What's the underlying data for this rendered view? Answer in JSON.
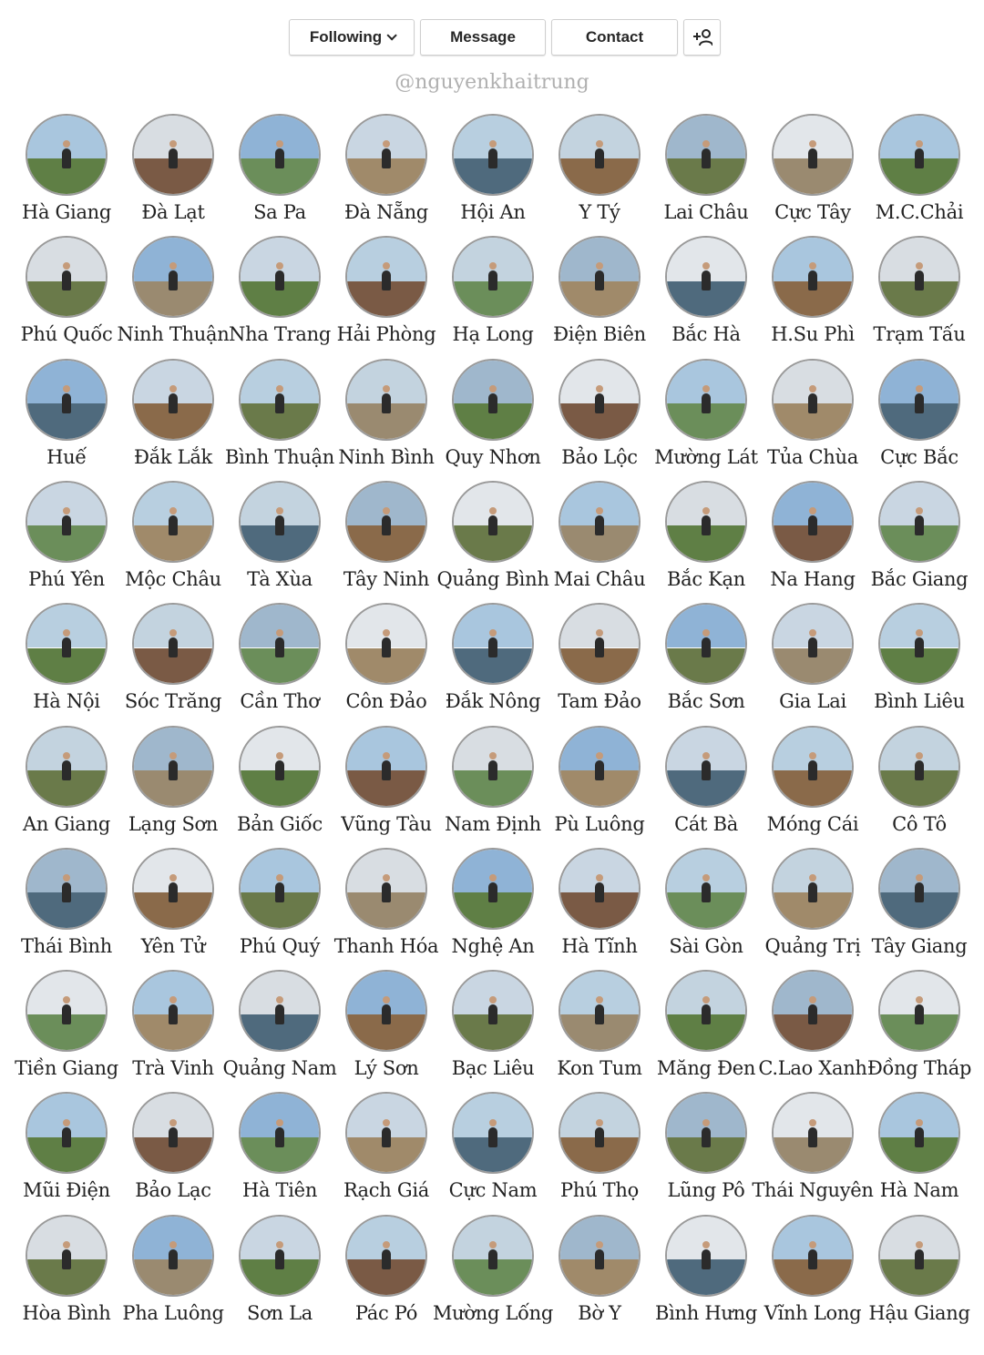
{
  "profile": {
    "following_label": "Following",
    "message_label": "Message",
    "contact_label": "Contact",
    "add_user_icon": "add-user-icon",
    "chevron_icon": "chevron-down-icon",
    "handle": "@nguyenkhaitrung"
  },
  "highlights": [
    "Hà Giang",
    "Đà Lạt",
    "Sa Pa",
    "Đà Nẵng",
    "Hội An",
    "Y Tý",
    "Lai Châu",
    "Cực Tây",
    "M.C.Chải",
    "Phú Quốc",
    "Ninh Thuận",
    "Nha Trang",
    "Hải Phòng",
    "Hạ Long",
    "Điện Biên",
    "Bắc Hà",
    "H.Su Phì",
    "Trạm Tấu",
    "Huế",
    "Đắk Lắk",
    "Bình Thuận",
    "Ninh Bình",
    "Quy Nhơn",
    "Bảo Lộc",
    "Mường Lát",
    "Tủa Chùa",
    "Cực Bắc",
    "Phú Yên",
    "Mộc Châu",
    "Tà Xùa",
    "Tây Ninh",
    "Quảng Bình",
    "Mai Châu",
    "Bắc Kạn",
    "Na Hang",
    "Bắc Giang",
    "Hà Nội",
    "Sóc Trăng",
    "Cần Thơ",
    "Côn Đảo",
    "Đắk Nông",
    "Tam Đảo",
    "Bắc Sơn",
    "Gia Lai",
    "Bình Liêu",
    "An Giang",
    "Lạng Sơn",
    "Bản Giốc",
    "Vũng Tàu",
    "Nam Định",
    "Pù Luông",
    "Cát Bà",
    "Móng Cái",
    "Cô Tô",
    "Thái Bình",
    "Yên Tử",
    "Phú Quý",
    "Thanh Hóa",
    "Nghệ An",
    "Hà Tĩnh",
    "Sài Gòn",
    "Quảng Trị",
    "Tây Giang",
    "Tiền Giang",
    "Trà Vinh",
    "Quảng Nam",
    "Lý Sơn",
    "Bạc Liêu",
    "Kon Tum",
    "Măng Đen",
    "C.Lao Xanh",
    "Đồng Tháp",
    "Mũi Điện",
    "Bảo Lạc",
    "Hà Tiên",
    "Rạch Giá",
    "Cực Nam",
    "Phú Thọ",
    "Lũng Pô",
    "Thái Nguyên",
    "Hà Nam",
    "Hòa Bình",
    "Pha Luông",
    "Sơn La",
    "Pác Pó",
    "Mường Lống",
    "Bờ Y",
    "Bình Hưng",
    "Vĩnh Long",
    "Hậu Giang"
  ],
  "palette": {
    "skies": [
      "#a9c6de",
      "#c9d6e2",
      "#9fb7cc",
      "#d8dde2",
      "#b8cfe0",
      "#e2e6ea",
      "#8fb3d6",
      "#c3d3df"
    ],
    "grounds": [
      "#5f7f45",
      "#8a6a4a",
      "#6b8e5a",
      "#9a8a70",
      "#4f6a7d",
      "#7a5a45",
      "#6a7a4a",
      "#a08a6a"
    ]
  }
}
